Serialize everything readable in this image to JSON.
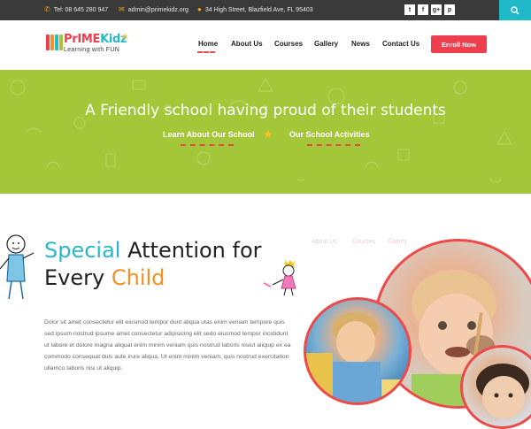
{
  "topbar": {
    "phone": "Tel: 08 645 280 947",
    "email": "admin@primekidz.org",
    "address": "34 High Street, Blazfield Ave, FL 95403",
    "social": [
      "twitter",
      "facebook",
      "google-plus",
      "pinterest"
    ],
    "social_glyphs": [
      "t",
      "f",
      "g+",
      "p"
    ]
  },
  "logo": {
    "title_part1": "PrIME",
    "title_part2": "Kidz",
    "tagline": "Learning with FUN"
  },
  "nav": {
    "items": [
      {
        "label": "Home",
        "active": true
      },
      {
        "label": "About Us"
      },
      {
        "label": "Courses"
      },
      {
        "label": "Gallery"
      },
      {
        "label": "News"
      },
      {
        "label": "Contact Us"
      }
    ],
    "cta": "Enroll Now"
  },
  "hero": {
    "title": "A Friendly school having proud of their students",
    "link1": "Learn About Our School",
    "link2": "Our School Activities"
  },
  "content": {
    "heading_word1": "Special",
    "heading_rest1": "Attention for",
    "heading_word2": "Every",
    "heading_word3": "Child",
    "paragraph": "Dolor sit amet consectetur elit eiusmod tempor dunt aliqua utas enim veniam tempore quis sed ipsum nostrud ipsume amet consectetur adipisicing elit sedo eiusmod tempor incididunt ut labore et dolore magna aliquat enim minim veniam quis nostrud laboris nisiut aliquip ex ea commodo consequat duis aute irure aliqua. Ut enim minim veniam, quis nostrud exercitation ullamco laboris nisi ut aliquip."
  },
  "colors": {
    "accent_teal": "#28b8c8",
    "accent_orange": "#f29023",
    "accent_red": "#ee3f4e",
    "hero_green": "#a4c73a"
  }
}
